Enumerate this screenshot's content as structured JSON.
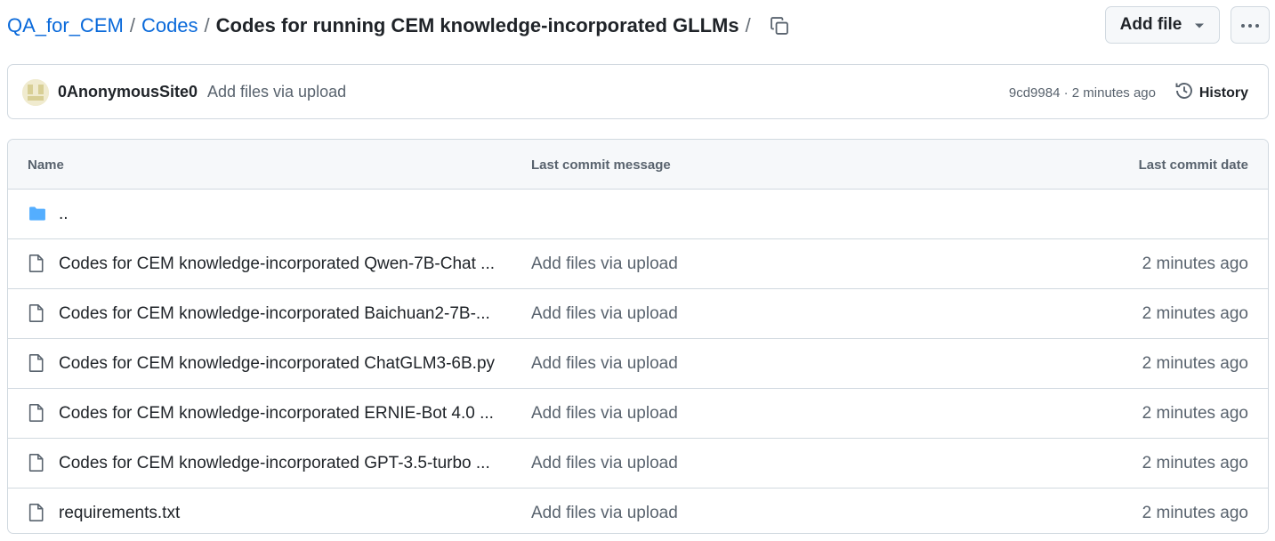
{
  "breadcrumb": {
    "repo": "QA_for_CEM",
    "folder": "Codes",
    "current": "Codes for running CEM knowledge-incorporated GLLMs",
    "separator": "/"
  },
  "toolbar": {
    "add_file_label": "Add file",
    "more_icon": "kebab-horizontal-icon",
    "copy_icon": "copy-icon"
  },
  "latest_commit": {
    "author": "0AnonymousSite0",
    "message": "Add files via upload",
    "meta": "9cd9984 · 2 minutes ago",
    "history_label": "History"
  },
  "table": {
    "headers": {
      "name": "Name",
      "message": "Last commit message",
      "date": "Last commit date"
    },
    "parent_dir": "..",
    "rows": [
      {
        "name": "Codes for CEM knowledge-incorporated Qwen-7B-Chat ...",
        "message": "Add files via upload",
        "date": "2 minutes ago"
      },
      {
        "name": "Codes for CEM knowledge-incorporated Baichuan2-7B-...",
        "message": "Add files via upload",
        "date": "2 minutes ago"
      },
      {
        "name": "Codes for CEM knowledge-incorporated ChatGLM3-6B.py",
        "message": "Add files via upload",
        "date": "2 minutes ago"
      },
      {
        "name": "Codes for CEM knowledge-incorporated ERNIE-Bot 4.0 ...",
        "message": "Add files via upload",
        "date": "2 minutes ago"
      },
      {
        "name": "Codes for CEM knowledge-incorporated GPT-3.5-turbo ...",
        "message": "Add files via upload",
        "date": "2 minutes ago"
      },
      {
        "name": "requirements.txt",
        "message": "Add files via upload",
        "date": "2 minutes ago"
      }
    ]
  },
  "colors": {
    "link": "#0969da",
    "text": "#1f2328",
    "muted": "#59636e",
    "border": "#d1d9e0",
    "folder": "#54aeff"
  }
}
